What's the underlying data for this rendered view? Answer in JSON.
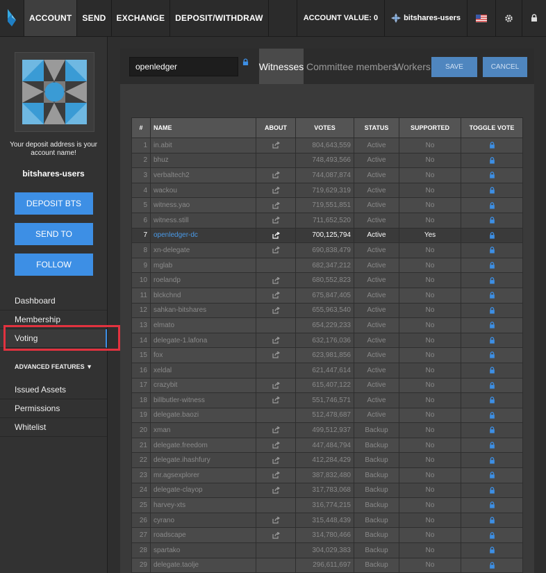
{
  "topbar": {
    "nav": [
      "ACCOUNT",
      "SEND",
      "EXCHANGE",
      "DEPOSIT/WITHDRAW"
    ],
    "account_value": "ACCOUNT VALUE: 0",
    "account_name": "bitshares-users"
  },
  "sidebar": {
    "deposit_note": "Your deposit address is your account name!",
    "account_name": "bitshares-users",
    "buttons": [
      "DEPOSIT BTS",
      "SEND TO",
      "FOLLOW"
    ],
    "menu": [
      "Dashboard",
      "Membership",
      "Voting"
    ],
    "advanced": "ADVANCED FEATURES ▼",
    "adv_menu": [
      "Issued Assets",
      "Permissions",
      "Whitelist"
    ]
  },
  "main": {
    "search_value": "openledger",
    "tabs": [
      "Witnesses",
      "Committee members",
      "Workers"
    ],
    "save": "SAVE",
    "cancel": "CANCEL",
    "headers": [
      "#",
      "NAME",
      "ABOUT",
      "VOTES",
      "STATUS",
      "SUPPORTED",
      "TOGGLE VOTE"
    ],
    "rows": [
      {
        "n": "1",
        "name": "in.abit",
        "about": true,
        "votes": "804,643,559",
        "status": "Active",
        "supported": "No"
      },
      {
        "n": "2",
        "name": "bhuz",
        "about": false,
        "votes": "748,493,566",
        "status": "Active",
        "supported": "No"
      },
      {
        "n": "3",
        "name": "verbaltech2",
        "about": true,
        "votes": "744,087,874",
        "status": "Active",
        "supported": "No"
      },
      {
        "n": "4",
        "name": "wackou",
        "about": true,
        "votes": "719,629,319",
        "status": "Active",
        "supported": "No"
      },
      {
        "n": "5",
        "name": "witness.yao",
        "about": true,
        "votes": "719,551,851",
        "status": "Active",
        "supported": "No"
      },
      {
        "n": "6",
        "name": "witness.still",
        "about": true,
        "votes": "711,652,520",
        "status": "Active",
        "supported": "No"
      },
      {
        "n": "7",
        "name": "openledger-dc",
        "about": true,
        "votes": "700,125,794",
        "status": "Active",
        "supported": "Yes",
        "sel": true
      },
      {
        "n": "8",
        "name": "xn-delegate",
        "about": true,
        "votes": "690,838,479",
        "status": "Active",
        "supported": "No"
      },
      {
        "n": "9",
        "name": "mglab",
        "about": false,
        "votes": "682,347,212",
        "status": "Active",
        "supported": "No"
      },
      {
        "n": "10",
        "name": "roelandp",
        "about": true,
        "votes": "680,552,823",
        "status": "Active",
        "supported": "No"
      },
      {
        "n": "11",
        "name": "blckchnd",
        "about": true,
        "votes": "675,847,405",
        "status": "Active",
        "supported": "No"
      },
      {
        "n": "12",
        "name": "sahkan-bitshares",
        "about": true,
        "votes": "655,963,540",
        "status": "Active",
        "supported": "No"
      },
      {
        "n": "13",
        "name": "elmato",
        "about": false,
        "votes": "654,229,233",
        "status": "Active",
        "supported": "No"
      },
      {
        "n": "14",
        "name": "delegate-1.lafona",
        "about": true,
        "votes": "632,176,036",
        "status": "Active",
        "supported": "No"
      },
      {
        "n": "15",
        "name": "fox",
        "about": true,
        "votes": "623,981,856",
        "status": "Active",
        "supported": "No"
      },
      {
        "n": "16",
        "name": "xeldal",
        "about": false,
        "votes": "621,447,614",
        "status": "Active",
        "supported": "No"
      },
      {
        "n": "17",
        "name": "crazybit",
        "about": true,
        "votes": "615,407,122",
        "status": "Active",
        "supported": "No"
      },
      {
        "n": "18",
        "name": "billbutler-witness",
        "about": true,
        "votes": "551,746,571",
        "status": "Active",
        "supported": "No"
      },
      {
        "n": "19",
        "name": "delegate.baozi",
        "about": false,
        "votes": "512,478,687",
        "status": "Active",
        "supported": "No"
      },
      {
        "n": "20",
        "name": "xman",
        "about": true,
        "votes": "499,512,937",
        "status": "Backup",
        "supported": "No"
      },
      {
        "n": "21",
        "name": "delegate.freedom",
        "about": true,
        "votes": "447,484,794",
        "status": "Backup",
        "supported": "No"
      },
      {
        "n": "22",
        "name": "delegate.ihashfury",
        "about": true,
        "votes": "412,284,429",
        "status": "Backup",
        "supported": "No"
      },
      {
        "n": "23",
        "name": "mr.agsexplorer",
        "about": true,
        "votes": "387,832,480",
        "status": "Backup",
        "supported": "No"
      },
      {
        "n": "24",
        "name": "delegate-clayop",
        "about": true,
        "votes": "317,783,068",
        "status": "Backup",
        "supported": "No"
      },
      {
        "n": "25",
        "name": "harvey-xts",
        "about": false,
        "votes": "316,774,215",
        "status": "Backup",
        "supported": "No"
      },
      {
        "n": "26",
        "name": "cyrano",
        "about": true,
        "votes": "315,448,439",
        "status": "Backup",
        "supported": "No"
      },
      {
        "n": "27",
        "name": "roadscape",
        "about": true,
        "votes": "314,780,466",
        "status": "Backup",
        "supported": "No"
      },
      {
        "n": "28",
        "name": "spartako",
        "about": false,
        "votes": "304,029,383",
        "status": "Backup",
        "supported": "No"
      },
      {
        "n": "29",
        "name": "delegate.taolje",
        "about": false,
        "votes": "296,611,697",
        "status": "Backup",
        "supported": "No"
      }
    ]
  }
}
